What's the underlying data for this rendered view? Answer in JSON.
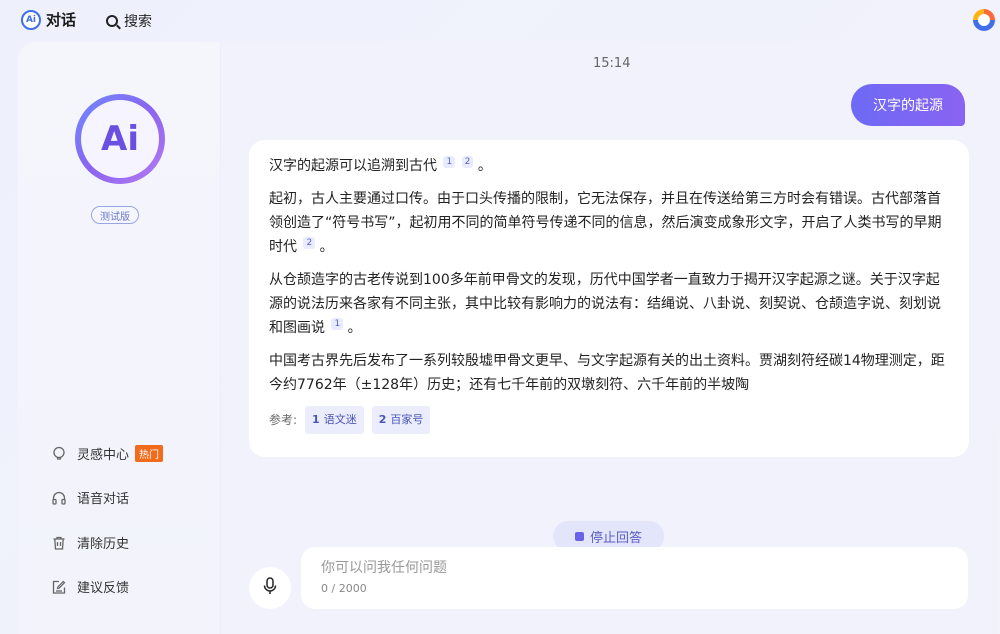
{
  "header": {
    "brand_name": "对话",
    "search_label": "搜索"
  },
  "sidebar": {
    "logo_text": "Ai",
    "badge": "测试版",
    "items": [
      {
        "label": "灵感中心",
        "badge": "热门",
        "icon": "lightbulb-icon"
      },
      {
        "label": "语音对话",
        "icon": "headphones-icon"
      },
      {
        "label": "清除历史",
        "icon": "trash-icon"
      },
      {
        "label": "建议反馈",
        "icon": "feedback-icon"
      }
    ]
  },
  "chat": {
    "time": "15:14",
    "user_message": "汉字的起源",
    "answer": {
      "p1": "汉字的起源可以追溯到古代",
      "p1_end": "。",
      "p2": "起初，古人主要通过口传。由于口头传播的限制，它无法保存，并且在传送给第三方时会有错误。古代部落首领创造了“符号书写”，起初用不同的简单符号传递不同的信息，然后演变成象形文字，开启了人类书写的早期时代",
      "p2_end": "。",
      "p3": "从仓颉造字的古老传说到100多年前甲骨文的发现，历代中国学者一直致力于揭开汉字起源之谜。关于汉字起源的说法历来各家有不同主张，其中比较有影响力的说法有：结绳说、八卦说、刻契说、仓颉造字说、刻划说和图画说",
      "p3_end": "。",
      "p4": "中国考古界先后发布了一系列较殷墟甲骨文更早、与文字起源有关的出土资料。贾湖刻符经碳14物理测定，距今约7762年（±128年）历史；还有七千年前的双墩刻符、六千年前的半坡陶",
      "cite1": "1",
      "cite2": "2"
    },
    "refs_label": "参考:",
    "refs": [
      {
        "num": "1",
        "name": "语文迷"
      },
      {
        "num": "2",
        "name": "百家号"
      }
    ]
  },
  "controls": {
    "stop_label": "停止回答",
    "input_placeholder": "你可以问我任何问题",
    "counter": "0 / 2000"
  },
  "colors": {
    "accent": "#7266f4",
    "hot": "#f26b1d"
  }
}
